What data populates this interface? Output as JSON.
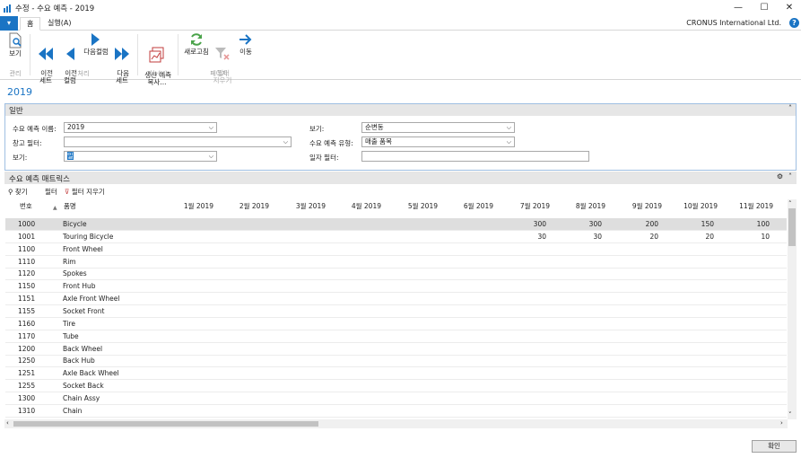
{
  "window": {
    "title": "수정 - 수요 예측 - 2019",
    "minimize": "—",
    "maximize": "☐",
    "close": "✕"
  },
  "tabs": {
    "menu": "▾",
    "home": "홈",
    "actions": "실행(A)"
  },
  "company": "CRONUS International Ltd.",
  "help": "?",
  "ribbon": {
    "view": "보기",
    "group_manage": "관리",
    "prev_set": "이전\n세트",
    "prev_col": "이전\n컬럼",
    "next_col": "다음컬럼",
    "next_set": "다음\n세트",
    "group_process": "처리",
    "copy_forecast": "생산 예측\n복사...",
    "group_function": "기능(U)",
    "refresh": "새로고침",
    "clear_filter": "필터\n지우기",
    "goto": "이동",
    "group_page": "페이지",
    "colors": {
      "blue": "#1a74c4",
      "green": "#4aa34a",
      "red": "#d9534f"
    }
  },
  "page_heading": "2019",
  "general": {
    "title": "일반",
    "collapse": "˄",
    "forecast_name_label": "수요 예측 이름:",
    "forecast_name_value": "2019",
    "location_filter_label": "창고 필터:",
    "location_filter_value": "",
    "view1_label": "보기:",
    "view1_value": "일",
    "view2_label": "보기:",
    "view2_value": "순변동",
    "forecast_type_label": "수요 예측 유형:",
    "forecast_type_value": "매출 품목",
    "date_filter_label": "일자 필터:",
    "date_filter_value": ""
  },
  "matrix": {
    "title": "수요 예측 매트릭스",
    "gear": "⚙",
    "collapse": "˄",
    "find": "찾기",
    "filter": "필터",
    "clear_filter": "필터 지우기",
    "col_no": "번호",
    "col_desc": "품명",
    "sort": "▲",
    "months": [
      "1월 2019",
      "2월 2019",
      "3월 2019",
      "4월 2019",
      "5월 2019",
      "6월 2019",
      "7월 2019",
      "8월 2019",
      "9월 2019",
      "10월 2019",
      "11월 2019"
    ],
    "rows": [
      {
        "no": "1000",
        "desc": "Bicycle",
        "vals": [
          "",
          "",
          "",
          "",
          "",
          "",
          "300",
          "300",
          "200",
          "150",
          "100"
        ]
      },
      {
        "no": "1001",
        "desc": "Touring Bicycle",
        "vals": [
          "",
          "",
          "",
          "",
          "",
          "",
          "30",
          "30",
          "20",
          "20",
          "10"
        ]
      },
      {
        "no": "1100",
        "desc": "Front Wheel",
        "vals": [
          "",
          "",
          "",
          "",
          "",
          "",
          "",
          "",
          "",
          "",
          ""
        ]
      },
      {
        "no": "1110",
        "desc": "Rim",
        "vals": [
          "",
          "",
          "",
          "",
          "",
          "",
          "",
          "",
          "",
          "",
          ""
        ]
      },
      {
        "no": "1120",
        "desc": "Spokes",
        "vals": [
          "",
          "",
          "",
          "",
          "",
          "",
          "",
          "",
          "",
          "",
          ""
        ]
      },
      {
        "no": "1150",
        "desc": "Front Hub",
        "vals": [
          "",
          "",
          "",
          "",
          "",
          "",
          "",
          "",
          "",
          "",
          ""
        ]
      },
      {
        "no": "1151",
        "desc": "Axle Front Wheel",
        "vals": [
          "",
          "",
          "",
          "",
          "",
          "",
          "",
          "",
          "",
          "",
          ""
        ]
      },
      {
        "no": "1155",
        "desc": "Socket Front",
        "vals": [
          "",
          "",
          "",
          "",
          "",
          "",
          "",
          "",
          "",
          "",
          ""
        ]
      },
      {
        "no": "1160",
        "desc": "Tire",
        "vals": [
          "",
          "",
          "",
          "",
          "",
          "",
          "",
          "",
          "",
          "",
          ""
        ]
      },
      {
        "no": "1170",
        "desc": "Tube",
        "vals": [
          "",
          "",
          "",
          "",
          "",
          "",
          "",
          "",
          "",
          "",
          ""
        ]
      },
      {
        "no": "1200",
        "desc": "Back Wheel",
        "vals": [
          "",
          "",
          "",
          "",
          "",
          "",
          "",
          "",
          "",
          "",
          ""
        ]
      },
      {
        "no": "1250",
        "desc": "Back Hub",
        "vals": [
          "",
          "",
          "",
          "",
          "",
          "",
          "",
          "",
          "",
          "",
          ""
        ]
      },
      {
        "no": "1251",
        "desc": "Axle Back Wheel",
        "vals": [
          "",
          "",
          "",
          "",
          "",
          "",
          "",
          "",
          "",
          "",
          ""
        ]
      },
      {
        "no": "1255",
        "desc": "Socket Back",
        "vals": [
          "",
          "",
          "",
          "",
          "",
          "",
          "",
          "",
          "",
          "",
          ""
        ]
      },
      {
        "no": "1300",
        "desc": "Chain Assy",
        "vals": [
          "",
          "",
          "",
          "",
          "",
          "",
          "",
          "",
          "",
          "",
          ""
        ]
      },
      {
        "no": "1310",
        "desc": "Chain",
        "vals": [
          "",
          "",
          "",
          "",
          "",
          "",
          "",
          "",
          "",
          "",
          ""
        ]
      }
    ]
  },
  "ok": "확인"
}
